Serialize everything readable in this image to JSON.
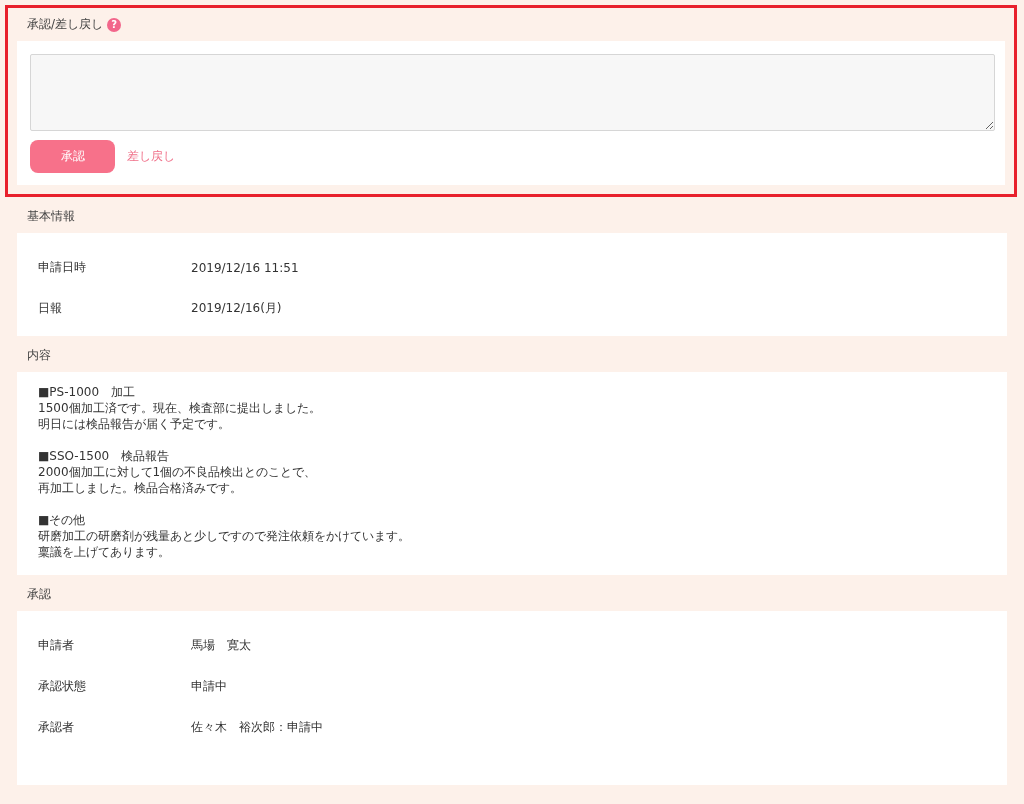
{
  "approval_form": {
    "title": "承認/差し戻し",
    "help_icon": "?",
    "approve_button": "承認",
    "return_link": "差し戻し"
  },
  "basic_info": {
    "title": "基本情報",
    "rows": [
      {
        "label": "申請日時",
        "value": "2019/12/16 11:51"
      },
      {
        "label": "日報",
        "value": "2019/12/16(月)"
      }
    ]
  },
  "content": {
    "title": "内容",
    "blocks": [
      [
        "■PS-1000　加工",
        "1500個加工済です。現在、検査部に提出しました。",
        "明日には検品報告が届く予定です。"
      ],
      [
        "■SSO-1500　検品報告",
        "2000個加工に対して1個の不良品検出とのことで、",
        "再加工しました。検品合格済みです。"
      ],
      [
        "■その他",
        "研磨加工の研磨剤が残量あと少しですので発注依頼をかけています。",
        "稟議を上げてあります。"
      ]
    ]
  },
  "approval": {
    "title": "承認",
    "rows": [
      {
        "label": "申請者",
        "value": "馬場　寛太"
      },
      {
        "label": "承認状態",
        "value": "申請中"
      },
      {
        "label": "承認者",
        "value": "佐々木　裕次郎：申請中"
      }
    ]
  }
}
